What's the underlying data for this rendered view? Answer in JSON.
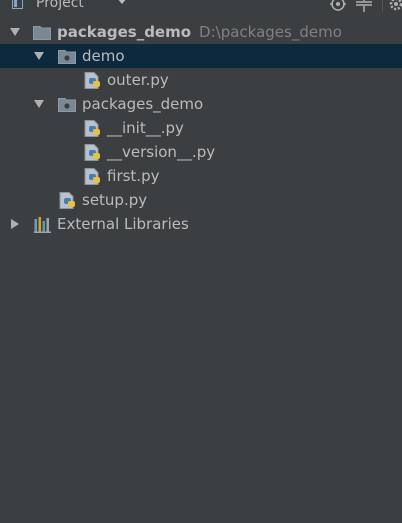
{
  "toolbar": {
    "view_label": "Project",
    "icons": [
      "project-icon",
      "dropdown-caret-icon",
      "locate-icon",
      "collapse-icon",
      "settings-icon"
    ]
  },
  "tree": {
    "root": {
      "label": "packages_demo",
      "path": "D:\\packages_demo",
      "icon": "folder-icon"
    },
    "demo": {
      "label": "demo",
      "icon": "package-folder-icon"
    },
    "outer": {
      "label": "outer.py",
      "icon": "python-file-icon"
    },
    "pkg": {
      "label": "packages_demo",
      "icon": "package-folder-icon"
    },
    "init": {
      "label": "__init__.py",
      "icon": "python-file-icon"
    },
    "version": {
      "label": "__version__.py",
      "icon": "python-file-icon"
    },
    "first": {
      "label": "first.py",
      "icon": "python-file-icon"
    },
    "setup": {
      "label": "setup.py",
      "icon": "python-file-icon"
    },
    "libraries": {
      "label": "External Libraries",
      "icon": "library-icon"
    }
  },
  "colors": {
    "background": "#3c3f41",
    "selection": "#0d293e",
    "text": "#bbbbbb",
    "path_text": "#808080"
  }
}
